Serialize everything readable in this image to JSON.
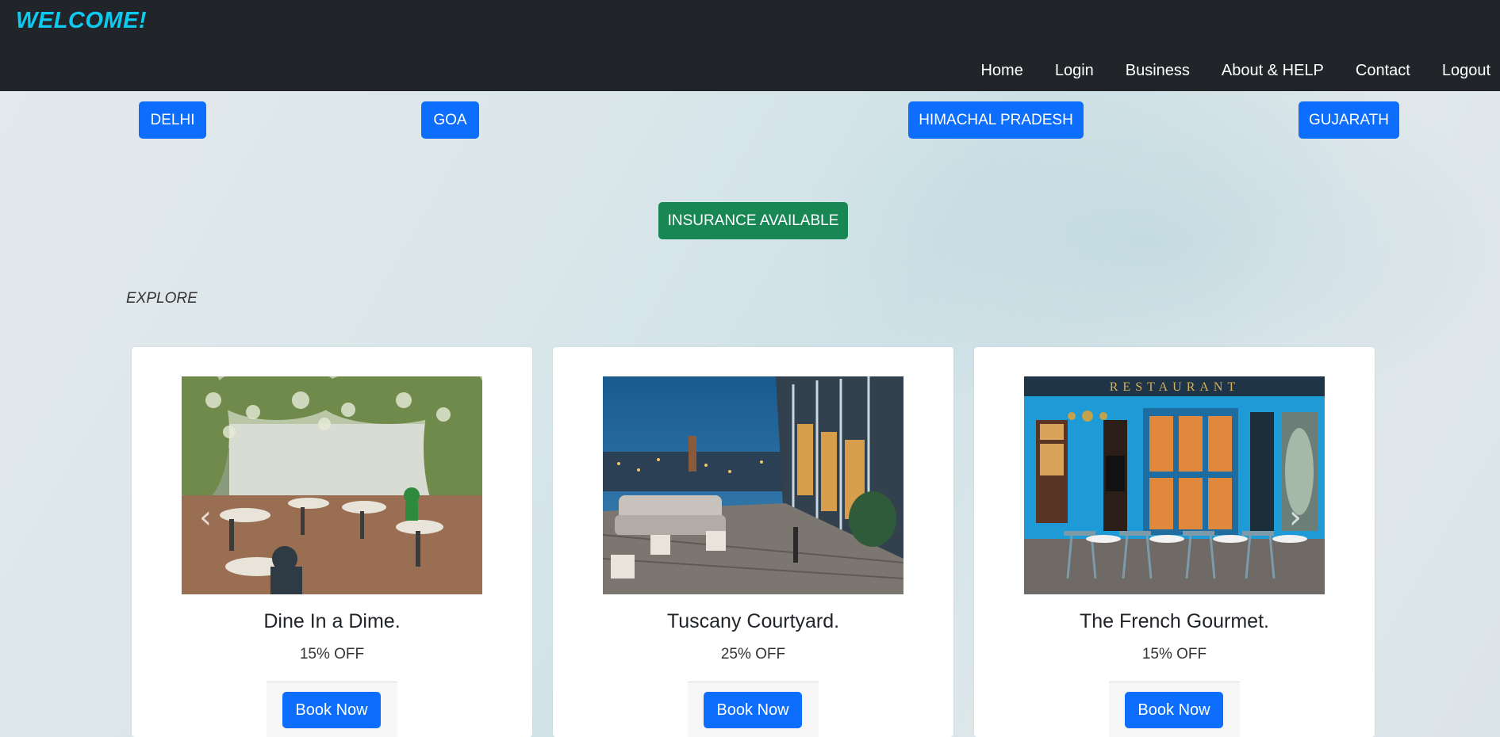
{
  "header": {
    "brand": "WELCOME!",
    "nav": [
      "Home",
      "Login",
      "Business",
      "About & HELP",
      "Contact",
      "Logout"
    ]
  },
  "destinations": [
    "DELHI",
    "GOA",
    "HIMACHAL PRADESH",
    "GUJARATH"
  ],
  "insurance_label": "INSURANCE AVAILABLE",
  "explore_label": "EXPLORE",
  "cards": [
    {
      "title": "Dine In a Dime.",
      "discount": "15% OFF",
      "button": "Book Now"
    },
    {
      "title": "Tuscany Courtyard.",
      "discount": "25% OFF",
      "button": "Book Now"
    },
    {
      "title": "The French Gourmet.",
      "discount": "15% OFF",
      "button": "Book Now"
    }
  ],
  "image3_sign": "RESTAURANT",
  "colors": {
    "navbar": "#212529",
    "brand": "#0dcaf0",
    "primary": "#0d6efd",
    "success": "#198754"
  },
  "icons": {
    "carousel_prev": "chevron-left-icon",
    "carousel_next": "chevron-right-icon"
  }
}
